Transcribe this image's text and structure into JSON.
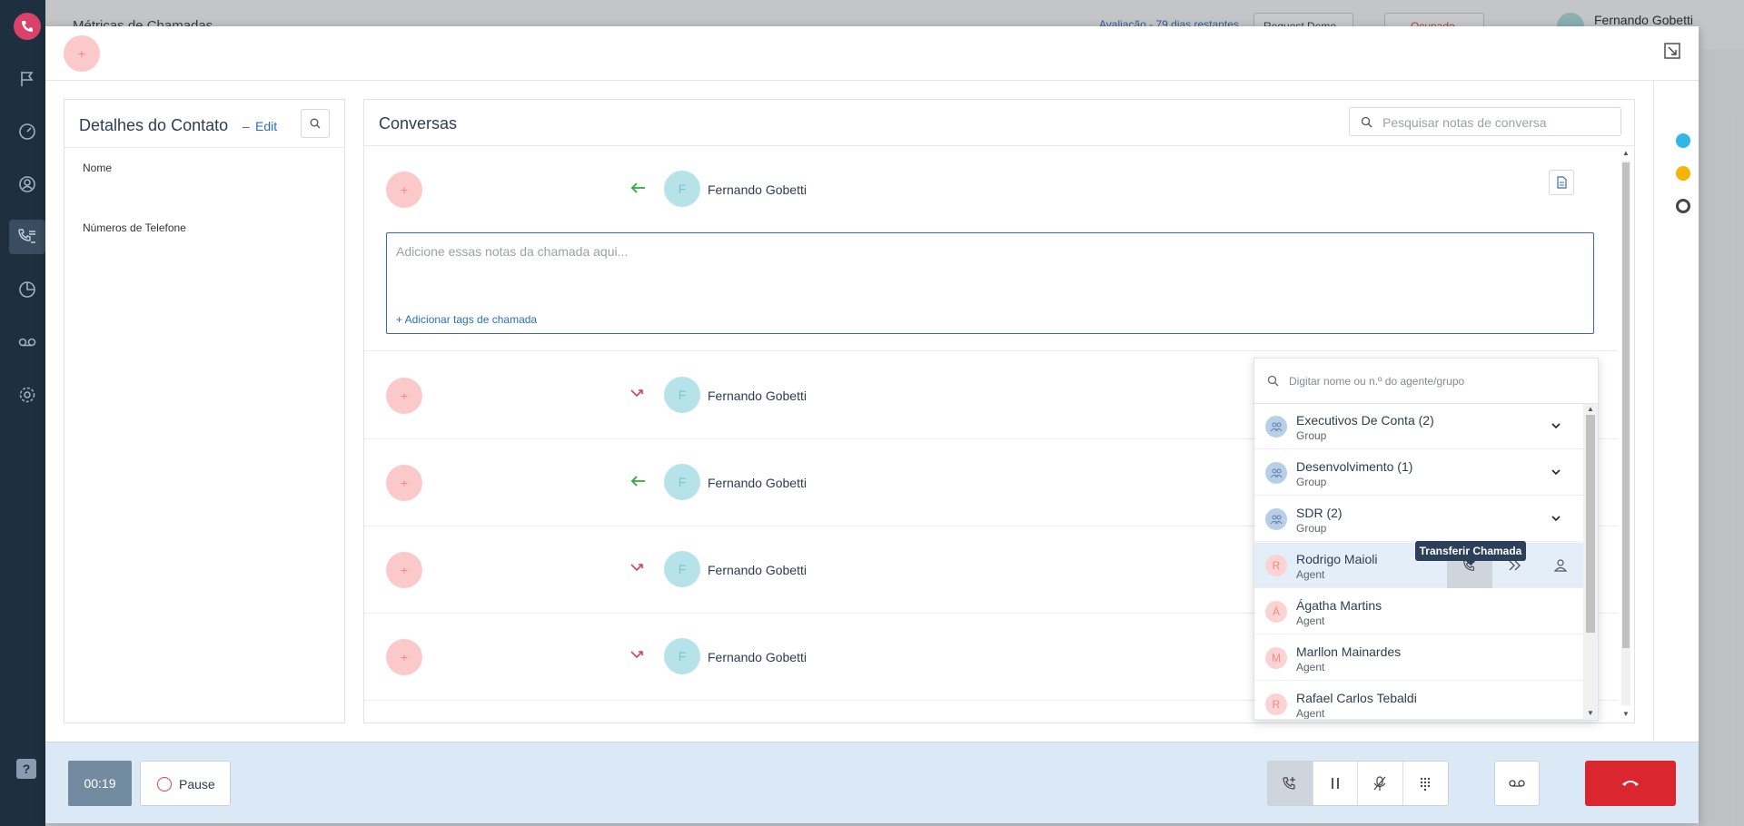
{
  "background": {
    "page_title": "Métricas de Chamadas",
    "trial": "Avaliação - 79 dias restantes",
    "request_demo": "Request Demo",
    "status": "Ocupado",
    "user_name": "Fernando Gobetti"
  },
  "modal": {
    "add_label": "+",
    "contact": {
      "title": "Detalhes do Contato",
      "dash": "–",
      "edit": "Edit",
      "name_label": "Nome",
      "phones_label": "Números de Telefone"
    },
    "conversations": {
      "title": "Conversas",
      "search_placeholder": "Pesquisar notas de conversa",
      "notes_placeholder": "Adicione essas notas da chamada aqui...",
      "add_tags": "+ Adicionar tags de chamada",
      "calls": [
        {
          "initial": "F",
          "name": "Fernando Gobetti",
          "direction": "incoming"
        },
        {
          "initial": "F",
          "name": "Fernando Gobetti",
          "direction": "missed"
        },
        {
          "initial": "F",
          "name": "Fernando Gobetti",
          "direction": "incoming"
        },
        {
          "initial": "F",
          "name": "Fernando Gobetti",
          "direction": "missed"
        },
        {
          "initial": "F",
          "name": "Fernando Gobetti",
          "direction": "missed"
        }
      ]
    }
  },
  "transfer": {
    "search_placeholder": "Digitar nome ou n.º do agente/grupo",
    "tooltip": "Transferir Chamada",
    "items": [
      {
        "name": "Executivos De Conta (2)",
        "type": "Group",
        "kind": "group"
      },
      {
        "name": "Desenvolvimento (1)",
        "type": "Group",
        "kind": "group"
      },
      {
        "name": "SDR (2)",
        "type": "Group",
        "kind": "group"
      },
      {
        "name": "Rodrigo Maioli",
        "type": "Agent",
        "kind": "agent",
        "initial": "R"
      },
      {
        "name": "Ágatha Martins",
        "type": "Agent",
        "kind": "agent",
        "initial": "Á"
      },
      {
        "name": "Marllon Mainardes",
        "type": "Agent",
        "kind": "agent",
        "initial": "M"
      },
      {
        "name": "Rafael Carlos Tebaldi",
        "type": "Agent",
        "kind": "agent",
        "initial": "R"
      }
    ]
  },
  "bottom": {
    "timer": "00:19",
    "pause": "Pause"
  },
  "colors": {
    "nav_bg": "#1e2f40",
    "accent": "#d9436b",
    "hangup": "#d9262f",
    "link": "#2a6ebb"
  }
}
